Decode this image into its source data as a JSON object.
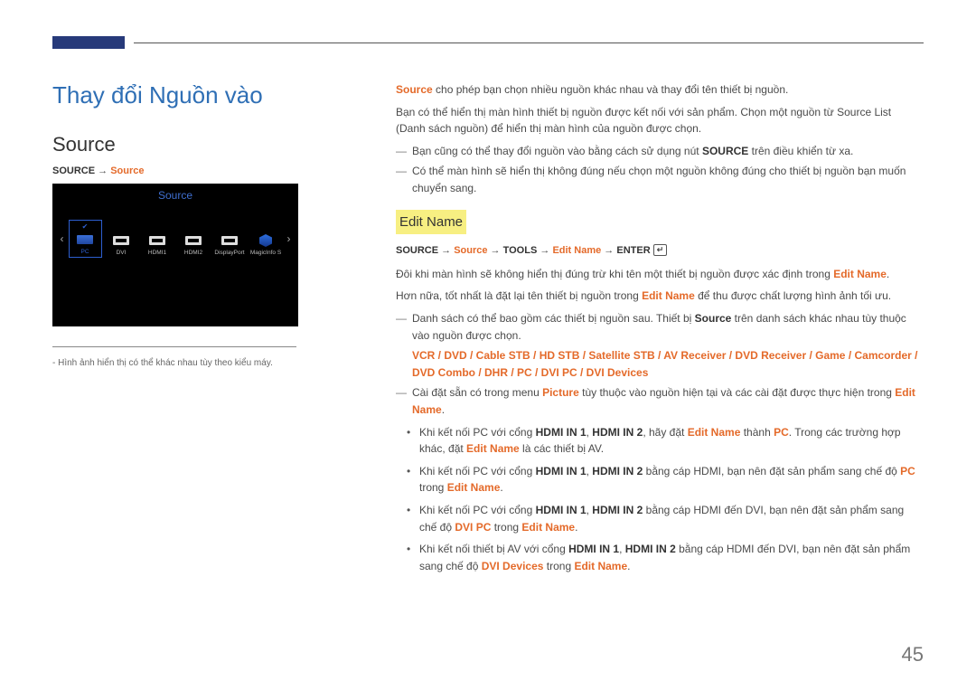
{
  "page_number": "45",
  "title": "Thay đổi Nguồn vào",
  "left": {
    "heading": "Source",
    "breadcrumb_parts": [
      "SOURCE",
      " → ",
      "Source"
    ],
    "osd_title": "Source",
    "items": [
      {
        "label": "PC",
        "selected": true
      },
      {
        "label": "DVI",
        "selected": false
      },
      {
        "label": "HDMI1",
        "selected": false
      },
      {
        "label": "HDMI2",
        "selected": false
      },
      {
        "label": "DisplayPort",
        "selected": false
      },
      {
        "label": "MagicInfo S",
        "selected": false
      }
    ],
    "note_prefix": "- ",
    "note": "Hình ảnh hiển thị có thể khác nhau tùy theo kiểu máy."
  },
  "right": {
    "p1_parts": [
      "Source",
      " cho phép bạn chọn nhiều nguồn khác nhau và thay đổi tên thiết bị nguồn."
    ],
    "p2_parts": [
      "Bạn có thể hiển thị màn hình thiết bị nguồn được kết nối với sản phẩm. Chọn một nguồn từ Source List (Danh sách nguồn) để hiển thị màn hình của nguồn được chọn."
    ],
    "dash1": {
      "pre": "Bạn cũng có thể thay đổi nguồn vào bằng cách sử dụng nút ",
      "bold": "SOURCE",
      "post": " trên điều khiển từ xa."
    },
    "dash2": "Có thể màn hình sẽ hiển thị không đúng nếu chọn một nguồn không đúng cho thiết bị nguồn bạn muốn chuyển sang.",
    "edit_heading": "Edit Name",
    "bc2": [
      "SOURCE",
      " → ",
      "Source",
      " → ",
      "TOOLS",
      " → ",
      "Edit Name",
      " → ",
      "ENTER"
    ],
    "p3": {
      "pre": "Đôi khi màn hình sẽ không hiển thị đúng trừ khi tên một thiết bị nguồn được xác định trong ",
      "orange": "Edit Name",
      "post": "."
    },
    "p4": {
      "pre": "Hơn nữa, tốt nhất là đặt lại tên thiết bị nguồn trong ",
      "orange": "Edit Name",
      "post": " để thu được chất lượng hình ảnh tối ưu."
    },
    "dash3": {
      "pre": "Danh sách có thể bao gồm các thiết bị nguồn sau. Thiết bị ",
      "bold": "Source",
      "post": " trên danh sách khác nhau tùy thuộc vào nguồn được chọn."
    },
    "devices": "VCR / DVD / Cable STB / HD STB / Satellite STB / AV Receiver / DVD Receiver / Game / Camcorder / DVD Combo / DHR / PC / DVI PC / DVI Devices",
    "dash4": {
      "pre": "Cài đặt sẵn có trong menu ",
      "orange1": "Picture",
      "mid": " tùy thuộc vào nguồn hiện tại và các cài đặt được thực hiện trong ",
      "orange2": "Edit Name",
      "post": "."
    },
    "b1": {
      "t1": "Khi kết nối PC với cổng ",
      "b1": "HDMI IN 1",
      "comma": ", ",
      "b2": "HDMI IN 2",
      "t2": ", hãy đặt ",
      "o1": "Edit Name",
      "t3": " thành ",
      "o2": "PC",
      "t4": ". Trong các trường hợp khác, đặt ",
      "o3": "Edit Name",
      "t5": " là các thiết bị AV."
    },
    "b2": {
      "t1": "Khi kết nối PC với cổng ",
      "hb1": "HDMI IN 1",
      "comma": ", ",
      "hb2": "HDMI IN 2",
      "t2": " bằng cáp HDMI, bạn nên đặt sản phẩm sang chế độ ",
      "o1": "PC",
      "t3": " trong ",
      "o2": "Edit Name",
      "t4": "."
    },
    "b3": {
      "t1": "Khi kết nối PC với cổng ",
      "hb1": "HDMI IN 1",
      "comma": ", ",
      "hb2": "HDMI IN 2",
      "t2": " bằng cáp HDMI đến DVI, bạn nên đặt sản phẩm sang chế độ ",
      "o1": "DVI PC",
      "t3": " trong ",
      "o2": "Edit Name",
      "t4": "."
    },
    "b4": {
      "t1": "Khi kết nối thiết bị AV với cổng ",
      "hb1": "HDMI IN 1",
      "comma": ", ",
      "hb2": "HDMI IN 2",
      "t2": " bằng cáp HDMI đến DVI, bạn nên đặt sản phẩm sang chế độ ",
      "o1": "DVI Devices",
      "t3": " trong ",
      "o2": "Edit Name",
      "t4": "."
    }
  }
}
